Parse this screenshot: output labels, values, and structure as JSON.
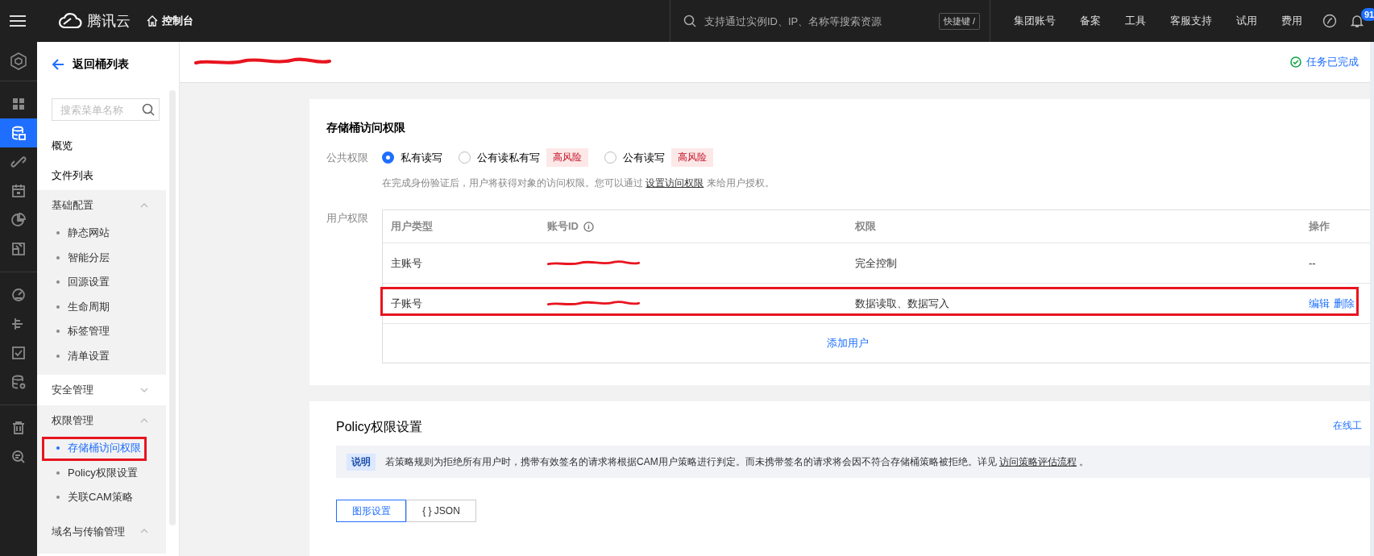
{
  "topbar": {
    "brand": "腾讯云",
    "console": "控制台",
    "search_placeholder": "支持通过实例ID、IP、名称等搜索资源",
    "shortcut": "快捷键 /",
    "links": [
      "集团账号",
      "备案",
      "工具",
      "客服支持",
      "试用",
      "费用"
    ],
    "notification_count": "91"
  },
  "rail": [
    {
      "kind": "grid",
      "selected": false
    },
    {
      "kind": "bucket",
      "selected": true
    },
    {
      "kind": "link",
      "selected": false
    },
    {
      "kind": "calendar",
      "selected": false
    },
    {
      "kind": "pie",
      "selected": false
    },
    {
      "kind": "report",
      "selected": false
    },
    {
      "kind": "gauge",
      "selected": false
    },
    {
      "kind": "tree",
      "selected": false
    },
    {
      "kind": "check",
      "selected": false
    },
    {
      "kind": "database",
      "selected": false
    },
    {
      "kind": "trash",
      "selected": false
    },
    {
      "kind": "zoom",
      "selected": false
    }
  ],
  "sidebar": {
    "back": "返回桶列表",
    "search_placeholder": "搜索菜单名称",
    "items": [
      {
        "label": "概览"
      },
      {
        "label": "文件列表"
      },
      {
        "label": "基础配置",
        "expanded": true,
        "children": [
          {
            "label": "静态网站",
            "selected": false,
            "annotated": false
          },
          {
            "label": "智能分层",
            "selected": false,
            "annotated": false
          },
          {
            "label": "回源设置",
            "selected": false,
            "annotated": false
          },
          {
            "label": "生命周期",
            "selected": false,
            "annotated": false
          },
          {
            "label": "标签管理",
            "selected": false,
            "annotated": false
          },
          {
            "label": "清单设置",
            "selected": false,
            "annotated": false
          }
        ]
      },
      {
        "label": "安全管理",
        "expanded": false
      },
      {
        "label": "权限管理",
        "expanded": true,
        "children": [
          {
            "label": "存储桶访问权限",
            "selected": true,
            "annotated": true
          },
          {
            "label": "Policy权限设置",
            "selected": false,
            "annotated": false
          },
          {
            "label": "关联CAM策略",
            "selected": false,
            "annotated": false
          }
        ]
      },
      {
        "label": "域名与传输管理",
        "expanded": true
      }
    ]
  },
  "header": {
    "status": "任务已完成"
  },
  "access_card": {
    "title": "存储桶访问权限",
    "public_label": "公共权限",
    "options": [
      {
        "label": "私有读写",
        "selected": true
      },
      {
        "label": "公有读私有写",
        "selected": false,
        "badge": "高风险"
      },
      {
        "label": "公有读写",
        "selected": false,
        "badge": "高风险"
      }
    ],
    "hint": {
      "before": "在完成身份验证后，用户将获得对象的访问权限。您可以通过 ",
      "link": "设置访问权限",
      "after": " 来给用户授权。"
    },
    "user_label": "用户权限",
    "table": {
      "columns": [
        "用户类型",
        "账号ID",
        "权限",
        "操作"
      ],
      "rows": [
        {
          "type": "主账号",
          "permission": "完全控制",
          "annotated": false,
          "actions": [
            {
              "kind": "text",
              "label": "--"
            }
          ]
        },
        {
          "type": "子账号",
          "permission": "数据读取、数据写入",
          "annotated": true,
          "actions": [
            {
              "kind": "link",
              "label": "编辑"
            },
            {
              "kind": "link",
              "label": "删除"
            }
          ]
        }
      ],
      "add_user": "添加用户"
    }
  },
  "policy_card": {
    "title": "Policy权限设置",
    "side_link": "在线工",
    "note_tag": "说明",
    "note": {
      "before": "若策略规则为拒绝所有用户时，携带有效签名的请求将根据CAM用户策略进行判定。而未携带签名的请求将会因不符合存储桶策略被拒绝。详见 ",
      "link": "访问策略评估流程",
      "after": " 。"
    },
    "tabs": [
      {
        "label": "图形设置",
        "selected": true
      },
      {
        "label": "{ } JSON",
        "selected": false
      }
    ]
  }
}
